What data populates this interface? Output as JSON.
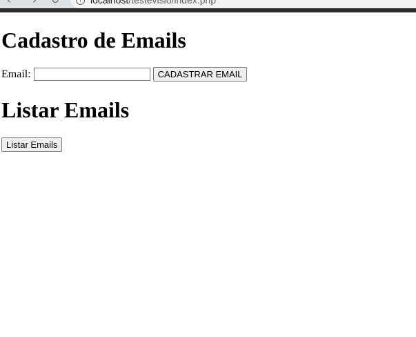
{
  "browser": {
    "url_host": "localhost",
    "url_path": "/testevisio/index.php"
  },
  "page": {
    "heading_cadastro": "Cadastro de Emails",
    "email_label": "Email:",
    "email_value": "",
    "email_placeholder": "",
    "cadastrar_button": "CADASTRAR EMAIL",
    "heading_listar": "Listar Emails",
    "listar_button": "Listar Emails"
  }
}
